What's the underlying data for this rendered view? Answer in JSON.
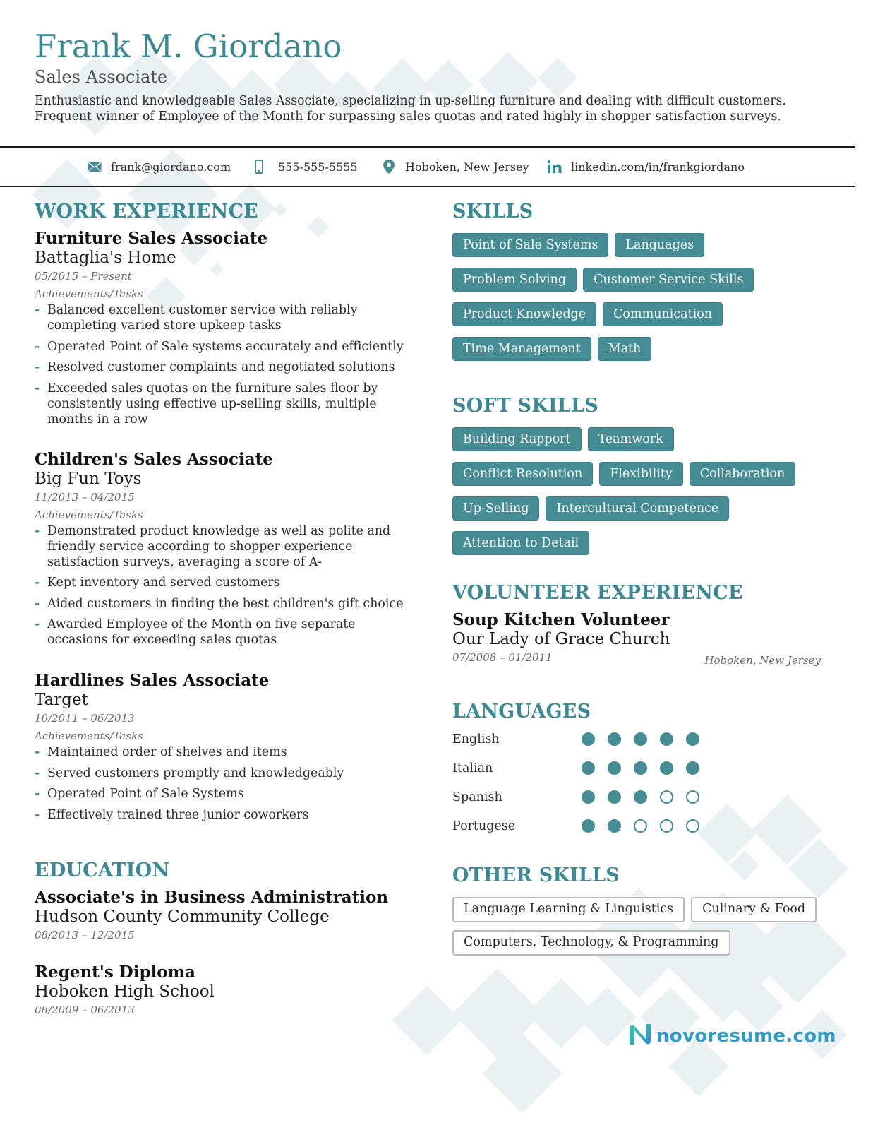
{
  "header": {
    "name": "Frank M. Giordano",
    "role": "Sales Associate",
    "summary_lines": [
      "Enthusiastic and knowledgeable Sales Associate, specializing in up-selling furniture and dealing with difficult customers.",
      "Frequent winner of Employee of the Month for surpassing sales quotas and rated highly in shopper satisfaction surveys."
    ]
  },
  "contact": {
    "email": {
      "icon": "envelope-icon",
      "text": "frank@giordano.com"
    },
    "phone": {
      "icon": "phone-icon",
      "text": "555-555-5555"
    },
    "location": {
      "icon": "map-pin-icon",
      "text": "Hoboken, New Jersey"
    },
    "linkedin": {
      "icon": "linkedin-icon",
      "text": "linkedin.com/in/frankgiordano"
    }
  },
  "work_experience": {
    "title": "WORK EXPERIENCE",
    "jobs": [
      {
        "title": "Furniture Sales Associate",
        "company": "Battaglia's Home",
        "dates": "05/2015 – Present",
        "label": "Achievements/Tasks",
        "bullets": [
          "Balanced excellent customer service with reliably completing varied store upkeep tasks",
          "Operated Point of Sale systems accurately and efficiently",
          "Resolved customer complaints and negotiated solutions",
          "Exceeded sales quotas on the furniture sales floor by consistently using effective up-selling skills, multiple months in a row"
        ]
      },
      {
        "title": "Children's Sales Associate",
        "company": "Big Fun Toys",
        "dates": "11/2013 – 04/2015",
        "label": "Achievements/Tasks",
        "bullets": [
          "Demonstrated product knowledge as well as polite and friendly service according to shopper experience satisfaction surveys, averaging a score of A-",
          "Kept inventory and served customers",
          "Aided customers in finding the best children's gift choice",
          "Awarded Employee of the Month on five separate occasions for exceeding sales quotas"
        ]
      },
      {
        "title": "Hardlines Sales Associate",
        "company": "Target",
        "dates": "10/2011 – 06/2013",
        "label": "Achievements/Tasks",
        "bullets": [
          "Maintained order of shelves and items",
          "Served customers promptly and knowledgeably",
          "Operated Point of Sale Systems",
          "Effectively trained three junior coworkers"
        ]
      }
    ]
  },
  "education": {
    "title": "EDUCATION",
    "items": [
      {
        "degree": "Associate's in Business Administration",
        "school": "Hudson County Community College",
        "dates": "08/2013 – 12/2015"
      },
      {
        "degree": "Regent's Diploma",
        "school": "Hoboken High School",
        "dates": "08/2009 – 06/2013"
      }
    ]
  },
  "skills": {
    "title": "SKILLS",
    "items": [
      "Point of Sale Systems",
      "Languages",
      "Problem Solving",
      "Customer Service Skills",
      "Product Knowledge",
      "Communication",
      "Time Management",
      "Math"
    ]
  },
  "soft_skills": {
    "title": "SOFT SKILLS",
    "items": [
      "Building Rapport",
      "Teamwork",
      "Conflict Resolution",
      "Flexibility",
      "Collaboration",
      "Up-Selling",
      "Intercultural Competence",
      "Attention to Detail"
    ]
  },
  "volunteer": {
    "title": "VOLUNTEER EXPERIENCE",
    "role": "Soup Kitchen Volunteer",
    "org": "Our Lady of Grace Church",
    "dates": "07/2008 – 01/2011",
    "location": "Hoboken, New Jersey"
  },
  "languages": {
    "title": "LANGUAGES",
    "max_level": 5,
    "items": [
      {
        "name": "English",
        "level": 5
      },
      {
        "name": "Italian",
        "level": 5
      },
      {
        "name": "Spanish",
        "level": 3
      },
      {
        "name": "Portugese",
        "level": 2
      }
    ]
  },
  "other_skills": {
    "title": "OTHER SKILLS",
    "items": [
      "Language Learning & Linguistics",
      "Culinary & Food",
      "Computers, Technology, & Programming"
    ]
  },
  "brand": {
    "text": "novoresume.com",
    "icon": "novoresume-logo-icon"
  },
  "colors": {
    "accent": "#3b8a93",
    "tag_bg": "#458c94",
    "brand": "#2f9bc9"
  }
}
